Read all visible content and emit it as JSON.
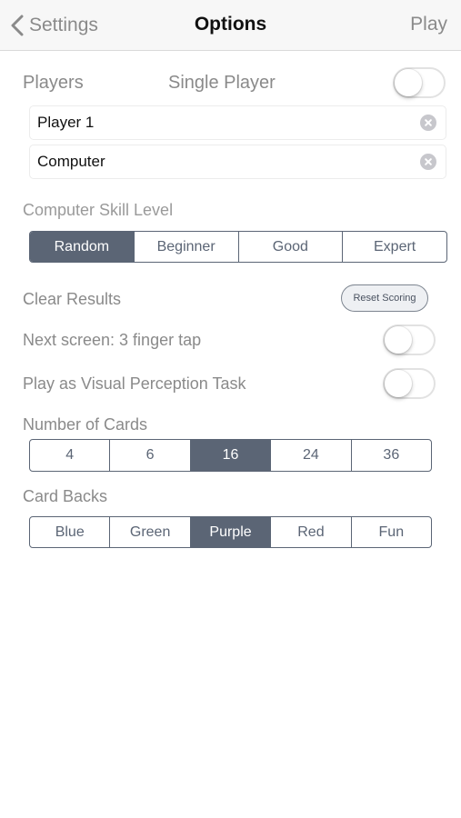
{
  "nav": {
    "back_label": "Settings",
    "title": "Options",
    "action_label": "Play"
  },
  "players": {
    "label": "Players",
    "mode_label": "Single Player",
    "single_player_on": false,
    "player1_value": "Player 1",
    "player2_value": "Computer"
  },
  "skill": {
    "label": "Computer Skill Level",
    "options": [
      "Random",
      "Beginner",
      "Good",
      "Expert"
    ],
    "selected": "Random"
  },
  "clear_results": {
    "label": "Clear Results",
    "button_label": "Reset Scoring"
  },
  "next_screen": {
    "label": "Next screen: 3 finger tap",
    "on": false
  },
  "visual_task": {
    "label": "Play as Visual Perception Task",
    "on": false
  },
  "cards": {
    "label": "Number of Cards",
    "options": [
      "4",
      "6",
      "16",
      "24",
      "36"
    ],
    "selected": "16"
  },
  "card_backs": {
    "label": "Card Backs",
    "options": [
      "Blue",
      "Green",
      "Purple",
      "Red",
      "Fun"
    ],
    "selected": "Purple"
  },
  "colors": {
    "accent": "#5b6575",
    "label_gray": "#8a8a8a",
    "nav_background": "#f7f7f7"
  }
}
